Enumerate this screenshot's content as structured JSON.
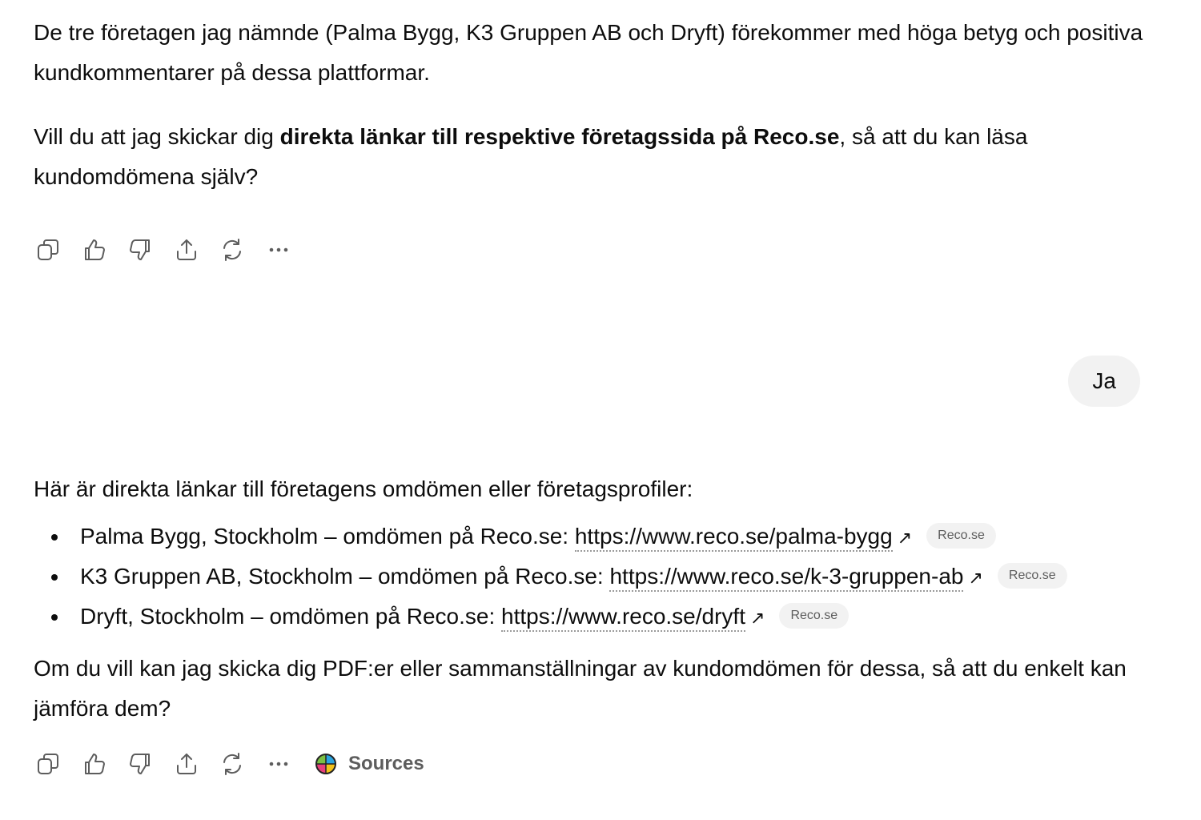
{
  "messages": {
    "p1": "De tre företagen jag nämnde (Palma Bygg, K3 Gruppen AB och Dryft) förekommer med höga betyg och positiva kundkommentarer på dessa plattformar.",
    "p2_before": "Vill du att jag skickar dig ",
    "p2_bold": "direkta länkar till respektive företagssida på Reco.se",
    "p2_after": ", så att du kan läsa kundomdömena själv?",
    "user_reply": "Ja",
    "p3": "Här är direkta länkar till företagens omdömen eller företagsprofiler:",
    "links": [
      {
        "text": "Palma Bygg, Stockholm – omdömen på Reco.se: ",
        "url": "https://www.reco.se/palma-bygg",
        "chip": "Reco.se"
      },
      {
        "text": "K3 Gruppen AB, Stockholm – omdömen på Reco.se: ",
        "url": "https://www.reco.se/k-3-gruppen-ab",
        "chip": "Reco.se"
      },
      {
        "text": "Dryft, Stockholm – omdömen på Reco.se: ",
        "url": "https://www.reco.se/dryft",
        "chip": "Reco.se"
      }
    ],
    "p4": "Om du vill kan jag skicka dig PDF:er eller sammanställningar av kundomdömen för dessa, så att du enkelt kan jämföra dem?"
  },
  "actions": {
    "icons": [
      "copy-icon",
      "thumbs-up-icon",
      "thumbs-down-icon",
      "share-icon",
      "regenerate-icon",
      "more-icon"
    ],
    "sources_label": "Sources",
    "external_glyph": "↗"
  }
}
